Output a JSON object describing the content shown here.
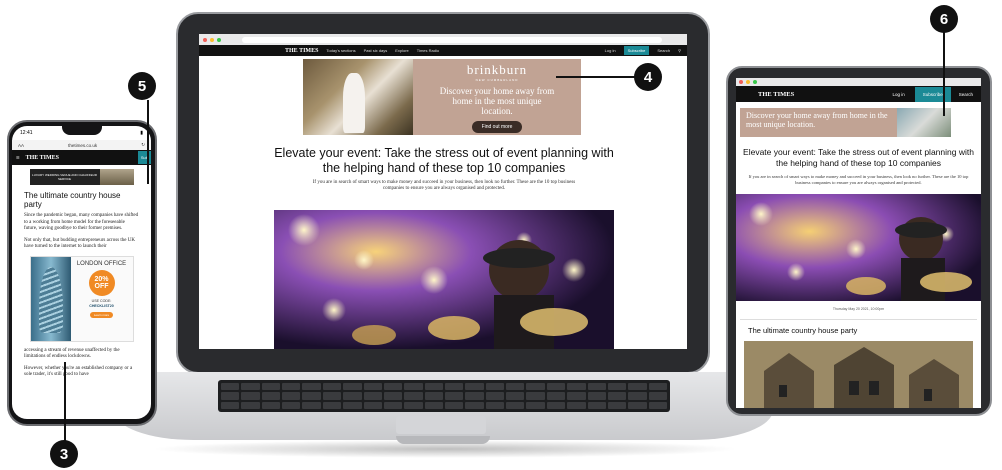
{
  "callouts": {
    "n3": "3",
    "n4": "4",
    "n5": "5",
    "n6": "6"
  },
  "laptop": {
    "nav": {
      "logo": "THE TIMES",
      "items": [
        "Today's sections",
        "Past six days",
        "Explore",
        "Times Radio"
      ],
      "login": "Log in",
      "subscribe": "Subscribe",
      "search": "Search"
    },
    "ad": {
      "brand": "brinkburn",
      "brand_sub": "NEW CUMBERLAND",
      "tagline": "Discover your home away from home in the most unique location.",
      "button": "Find out more"
    },
    "headline": "Elevate your event: Take the stress out of event planning with the helping hand of these top 10 companies",
    "lead": "If you are in search of smart ways to make money and succeed in your business, then look no further. These are the 10 top business companies to ensure you are always organised and protected."
  },
  "phone": {
    "time": "12:41",
    "aa": "AA",
    "url": "thetimes.co.uk",
    "nav": {
      "logo": "THE TIMES",
      "subscribe": "Sub"
    },
    "ad": {
      "text": "LUXURY WEDDING VENUE AND CHAUFFEUR SERVICE"
    },
    "title": "The ultimate country house party",
    "paragraphs": [
      "Since the pandemic began, many companies have shifted to a working from home model for the foreseeable future, waving goodbye to their former premises.",
      "Not only that, but budding entrepreneurs across the UK have turned to the internet to launch their"
    ],
    "promo": {
      "title": "LONDON OFFICE",
      "discount": "20%",
      "discount_label": "OFF",
      "code_label": "USE CODE:",
      "code": "CHECKLIST20",
      "button": "Learn more"
    },
    "paragraphs_after": [
      "accessing a stream of revenue unaffected by the limitations of endless lockdowns.",
      "However, whether you're an established company or a sole trader, it's still good to have"
    ]
  },
  "tablet": {
    "nav": {
      "logo": "THE TIMES",
      "login": "Log in",
      "subscribe": "Subscribe",
      "search": "Search"
    },
    "ad": {
      "tagline": "Discover your home away from home in the most unique location."
    },
    "headline": "Elevate your event: Take the stress out of event planning with the helping hand of these top 10 companies",
    "lead": "If you are in search of smart ways to make money and succeed in your business, then look no further. These are the 10 top business companies to ensure you are always organised and protected.",
    "date": "Thursday May 20 2021, 10:00pm",
    "card_title": "The ultimate country house party"
  }
}
